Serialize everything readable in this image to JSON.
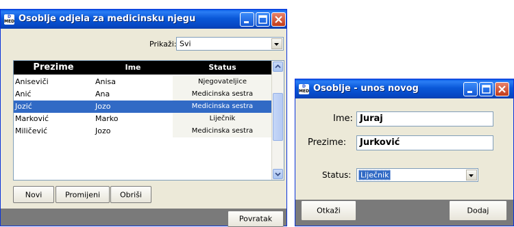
{
  "main_window": {
    "title": "Osoblje odjela za medicinsku njegu",
    "icon_text": [
      "D",
      "MED"
    ],
    "filter_label": "Prikaži:",
    "filter_value": "Svi",
    "columns": [
      "Prezime",
      "Ime",
      "Status"
    ],
    "rows": [
      {
        "prezime": "Aniseviči",
        "ime": "Anisa",
        "status": "Njegovateljice",
        "selected": false
      },
      {
        "prezime": "Anić",
        "ime": "Ana",
        "status": "Medicinska sestra",
        "selected": false
      },
      {
        "prezime": "Jozić",
        "ime": "Jozo",
        "status": "Medicinska sestra",
        "selected": true
      },
      {
        "prezime": "Marković",
        "ime": "Marko",
        "status": "Liječnik",
        "selected": false
      },
      {
        "prezime": "Miličević",
        "ime": "Jozo",
        "status": "Medicinska sestra",
        "selected": false
      }
    ],
    "buttons": {
      "new": "Novi",
      "edit": "Promijeni",
      "delete": "Obriši",
      "back": "Povratak"
    }
  },
  "entry_window": {
    "title": "Osoblje - unos novog",
    "icon_text": [
      "D",
      "MED"
    ],
    "first_name_label": "Ime:",
    "first_name_value": "Juraj",
    "last_name_label": "Prezime:",
    "last_name_value": "Jurković",
    "status_label": "Status:",
    "status_value": "Liječnik",
    "buttons": {
      "cancel": "Otkaži",
      "add": "Dodaj"
    }
  },
  "colors": {
    "title_bar": "#0a58d8",
    "selection": "#316ac5",
    "window_face": "#ece9d8",
    "bottom_bar": "#7a7a7a",
    "close_button": "#c23b1a"
  }
}
